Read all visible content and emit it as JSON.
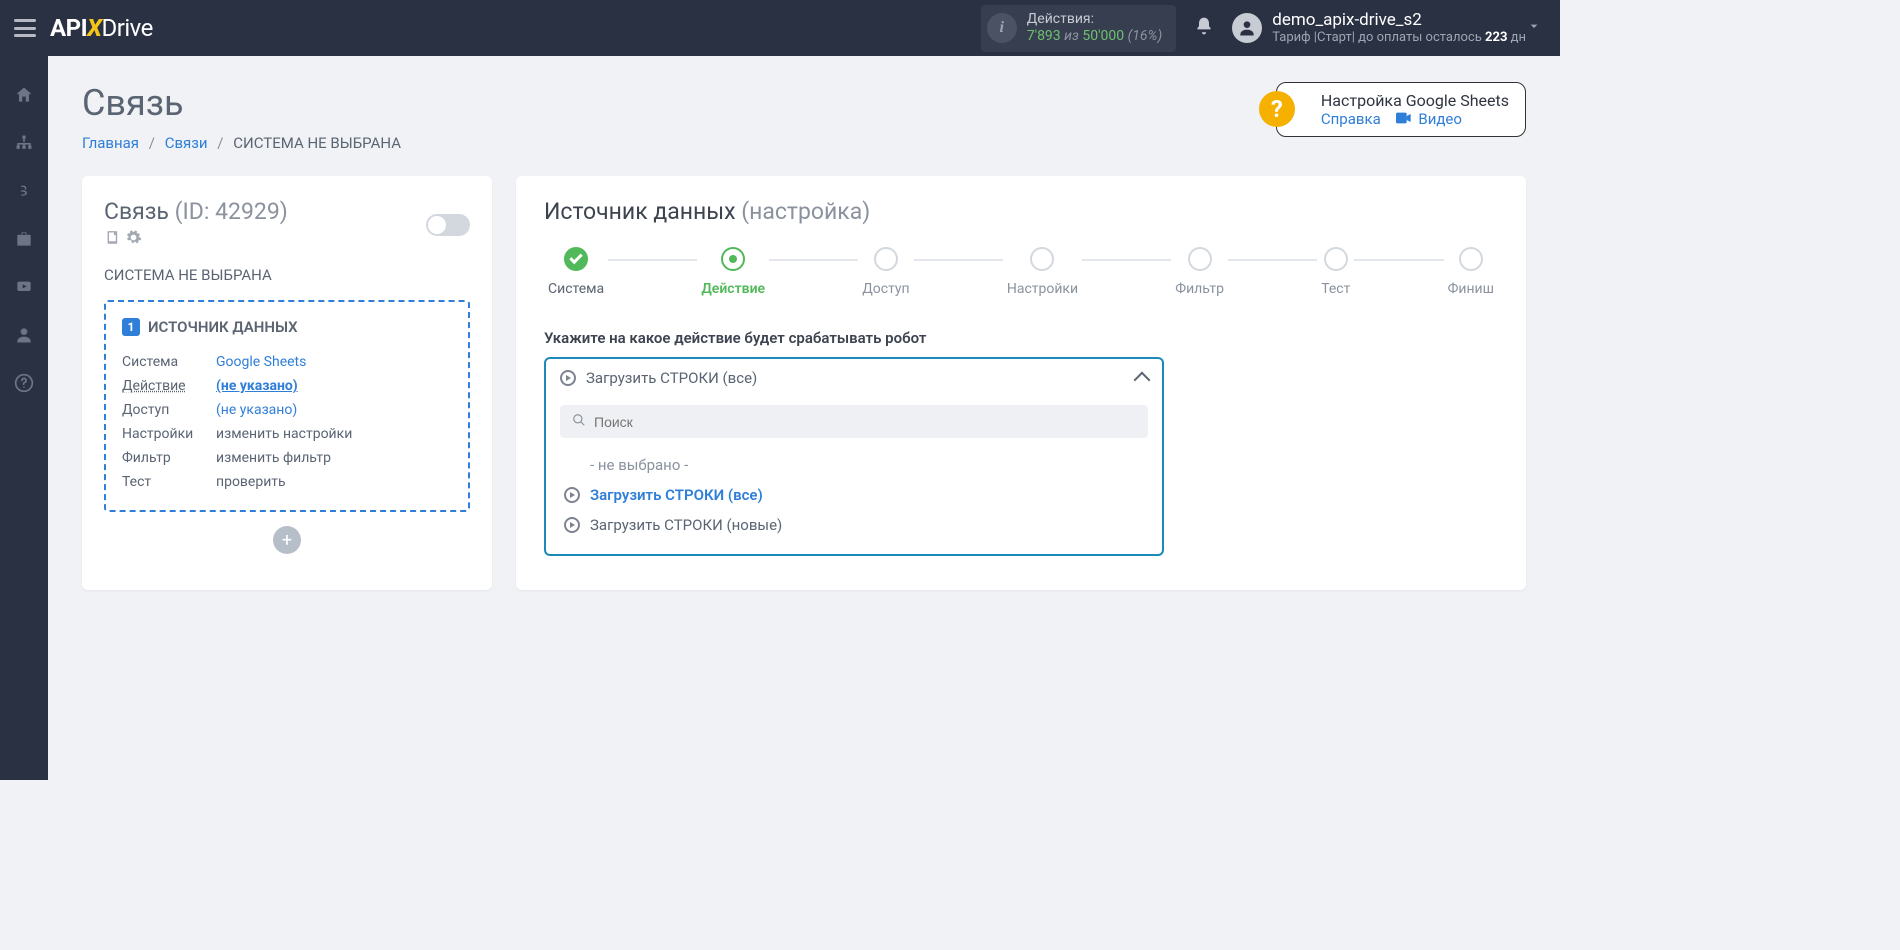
{
  "header": {
    "logo": {
      "p1": "API",
      "x": "X",
      "p2": "Drive"
    },
    "actions": {
      "label": "Действия:",
      "used": "7'893",
      "of": "из",
      "limit": "50'000",
      "percent": "(16%)"
    },
    "user": {
      "name": "demo_apix-drive_s2",
      "tariff_prefix": "Тариф |Старт| до оплаты осталось ",
      "days": "223",
      "days_suffix": " дн"
    }
  },
  "page": {
    "title": "Связь",
    "crumbs": {
      "home": "Главная",
      "links": "Связи",
      "current": "СИСТЕМА НЕ ВЫБРАНА"
    },
    "help": {
      "title": "Настройка Google Sheets",
      "ref": "Справка",
      "video": "Видео"
    }
  },
  "left": {
    "title_pre": "Связь ",
    "title_id": "(ID: 42929)",
    "system_line": "СИСТЕМА НЕ ВЫБРАНА",
    "src_title": "ИСТОЧНИК ДАННЫХ",
    "rows": {
      "system": {
        "k": "Система",
        "v": "Google Sheets"
      },
      "action": {
        "k": "Действие",
        "v": "(не указано)"
      },
      "access": {
        "k": "Доступ",
        "v": "(не указано)"
      },
      "settings": {
        "k": "Настройки",
        "v": "изменить настройки"
      },
      "filter": {
        "k": "Фильтр",
        "v": "изменить фильтр"
      },
      "test": {
        "k": "Тест",
        "v": "проверить"
      }
    }
  },
  "right": {
    "title": "Источник данных ",
    "title_sub": "(настройка)",
    "steps": [
      "Система",
      "Действие",
      "Доступ",
      "Настройки",
      "Фильтр",
      "Тест",
      "Финиш"
    ],
    "action_label": "Укажите на какое действие будет срабатывать робот",
    "select_current": "Загрузить СТРОКИ (все)",
    "search_placeholder": "Поиск",
    "options": {
      "none": "- не выбрано -",
      "all": "Загрузить СТРОКИ (все)",
      "new": "Загрузить СТРОКИ (новые)"
    }
  }
}
